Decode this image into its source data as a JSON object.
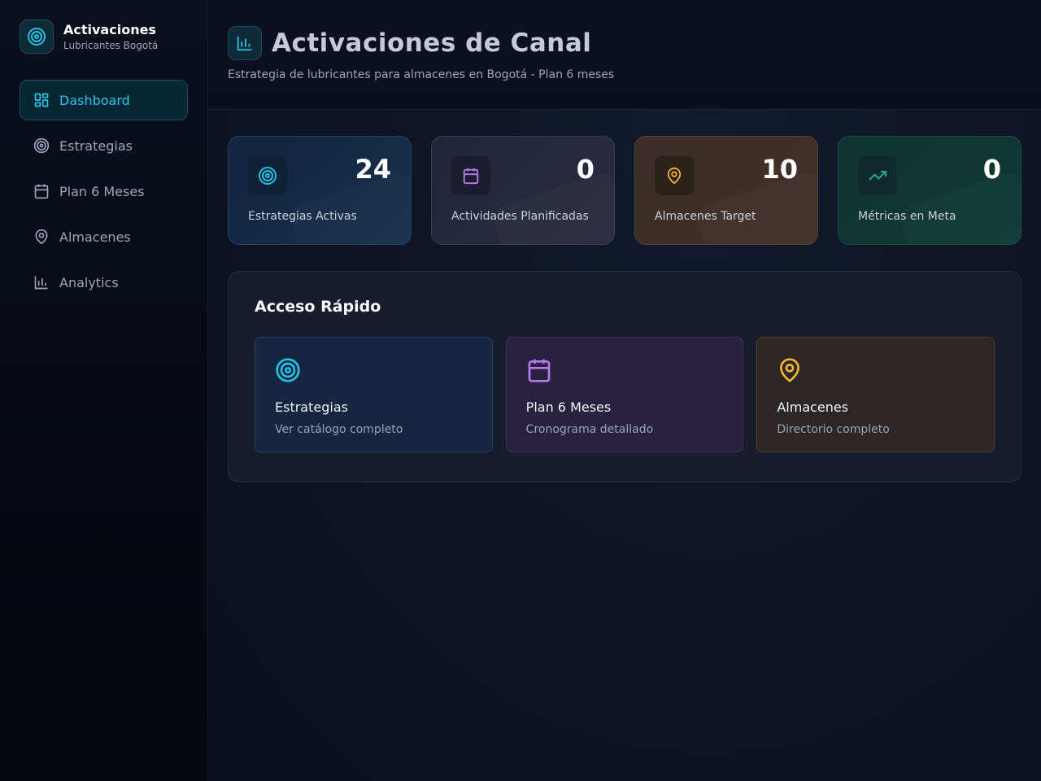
{
  "brand": {
    "title": "Activaciones",
    "subtitle": "Lubricantes Bogotá",
    "icon": "target-icon"
  },
  "sidebar": {
    "items": [
      {
        "label": "Dashboard",
        "icon": "dashboard-icon",
        "active": true
      },
      {
        "label": "Estrategias",
        "icon": "target-icon"
      },
      {
        "label": "Plan 6 Meses",
        "icon": "calendar-icon"
      },
      {
        "label": "Almacenes",
        "icon": "map-pin-icon"
      },
      {
        "label": "Analytics",
        "icon": "bar-chart-icon"
      }
    ]
  },
  "header": {
    "title": "Activaciones de Canal",
    "subtitle": "Estrategia de lubricantes para almacenes en Bogotá - Plan 6 meses",
    "icon": "bar-chart-icon"
  },
  "stats": [
    {
      "value": "24",
      "label": "Estrategias Activas",
      "icon": "target-icon",
      "color": "#22c3e6"
    },
    {
      "value": "0",
      "label": "Actividades Planificadas",
      "icon": "calendar-icon",
      "color": "#b57cf0"
    },
    {
      "value": "10",
      "label": "Almacenes Target",
      "icon": "map-pin-icon",
      "color": "#f3b62d"
    },
    {
      "value": "0",
      "label": "Métricas en Meta",
      "icon": "trending-up-icon",
      "color": "#22a89a"
    }
  ],
  "quick_access": {
    "title": "Acceso Rápido",
    "cards": [
      {
        "label": "Estrategias",
        "description": "Ver catálogo completo",
        "icon": "target-icon",
        "color": "#22c3e6"
      },
      {
        "label": "Plan 6 Meses",
        "description": "Cronograma detallado",
        "icon": "calendar-icon",
        "color": "#b57cf0"
      },
      {
        "label": "Almacenes",
        "description": "Directorio completo",
        "icon": "map-pin-icon",
        "color": "#f3b62d"
      }
    ]
  }
}
